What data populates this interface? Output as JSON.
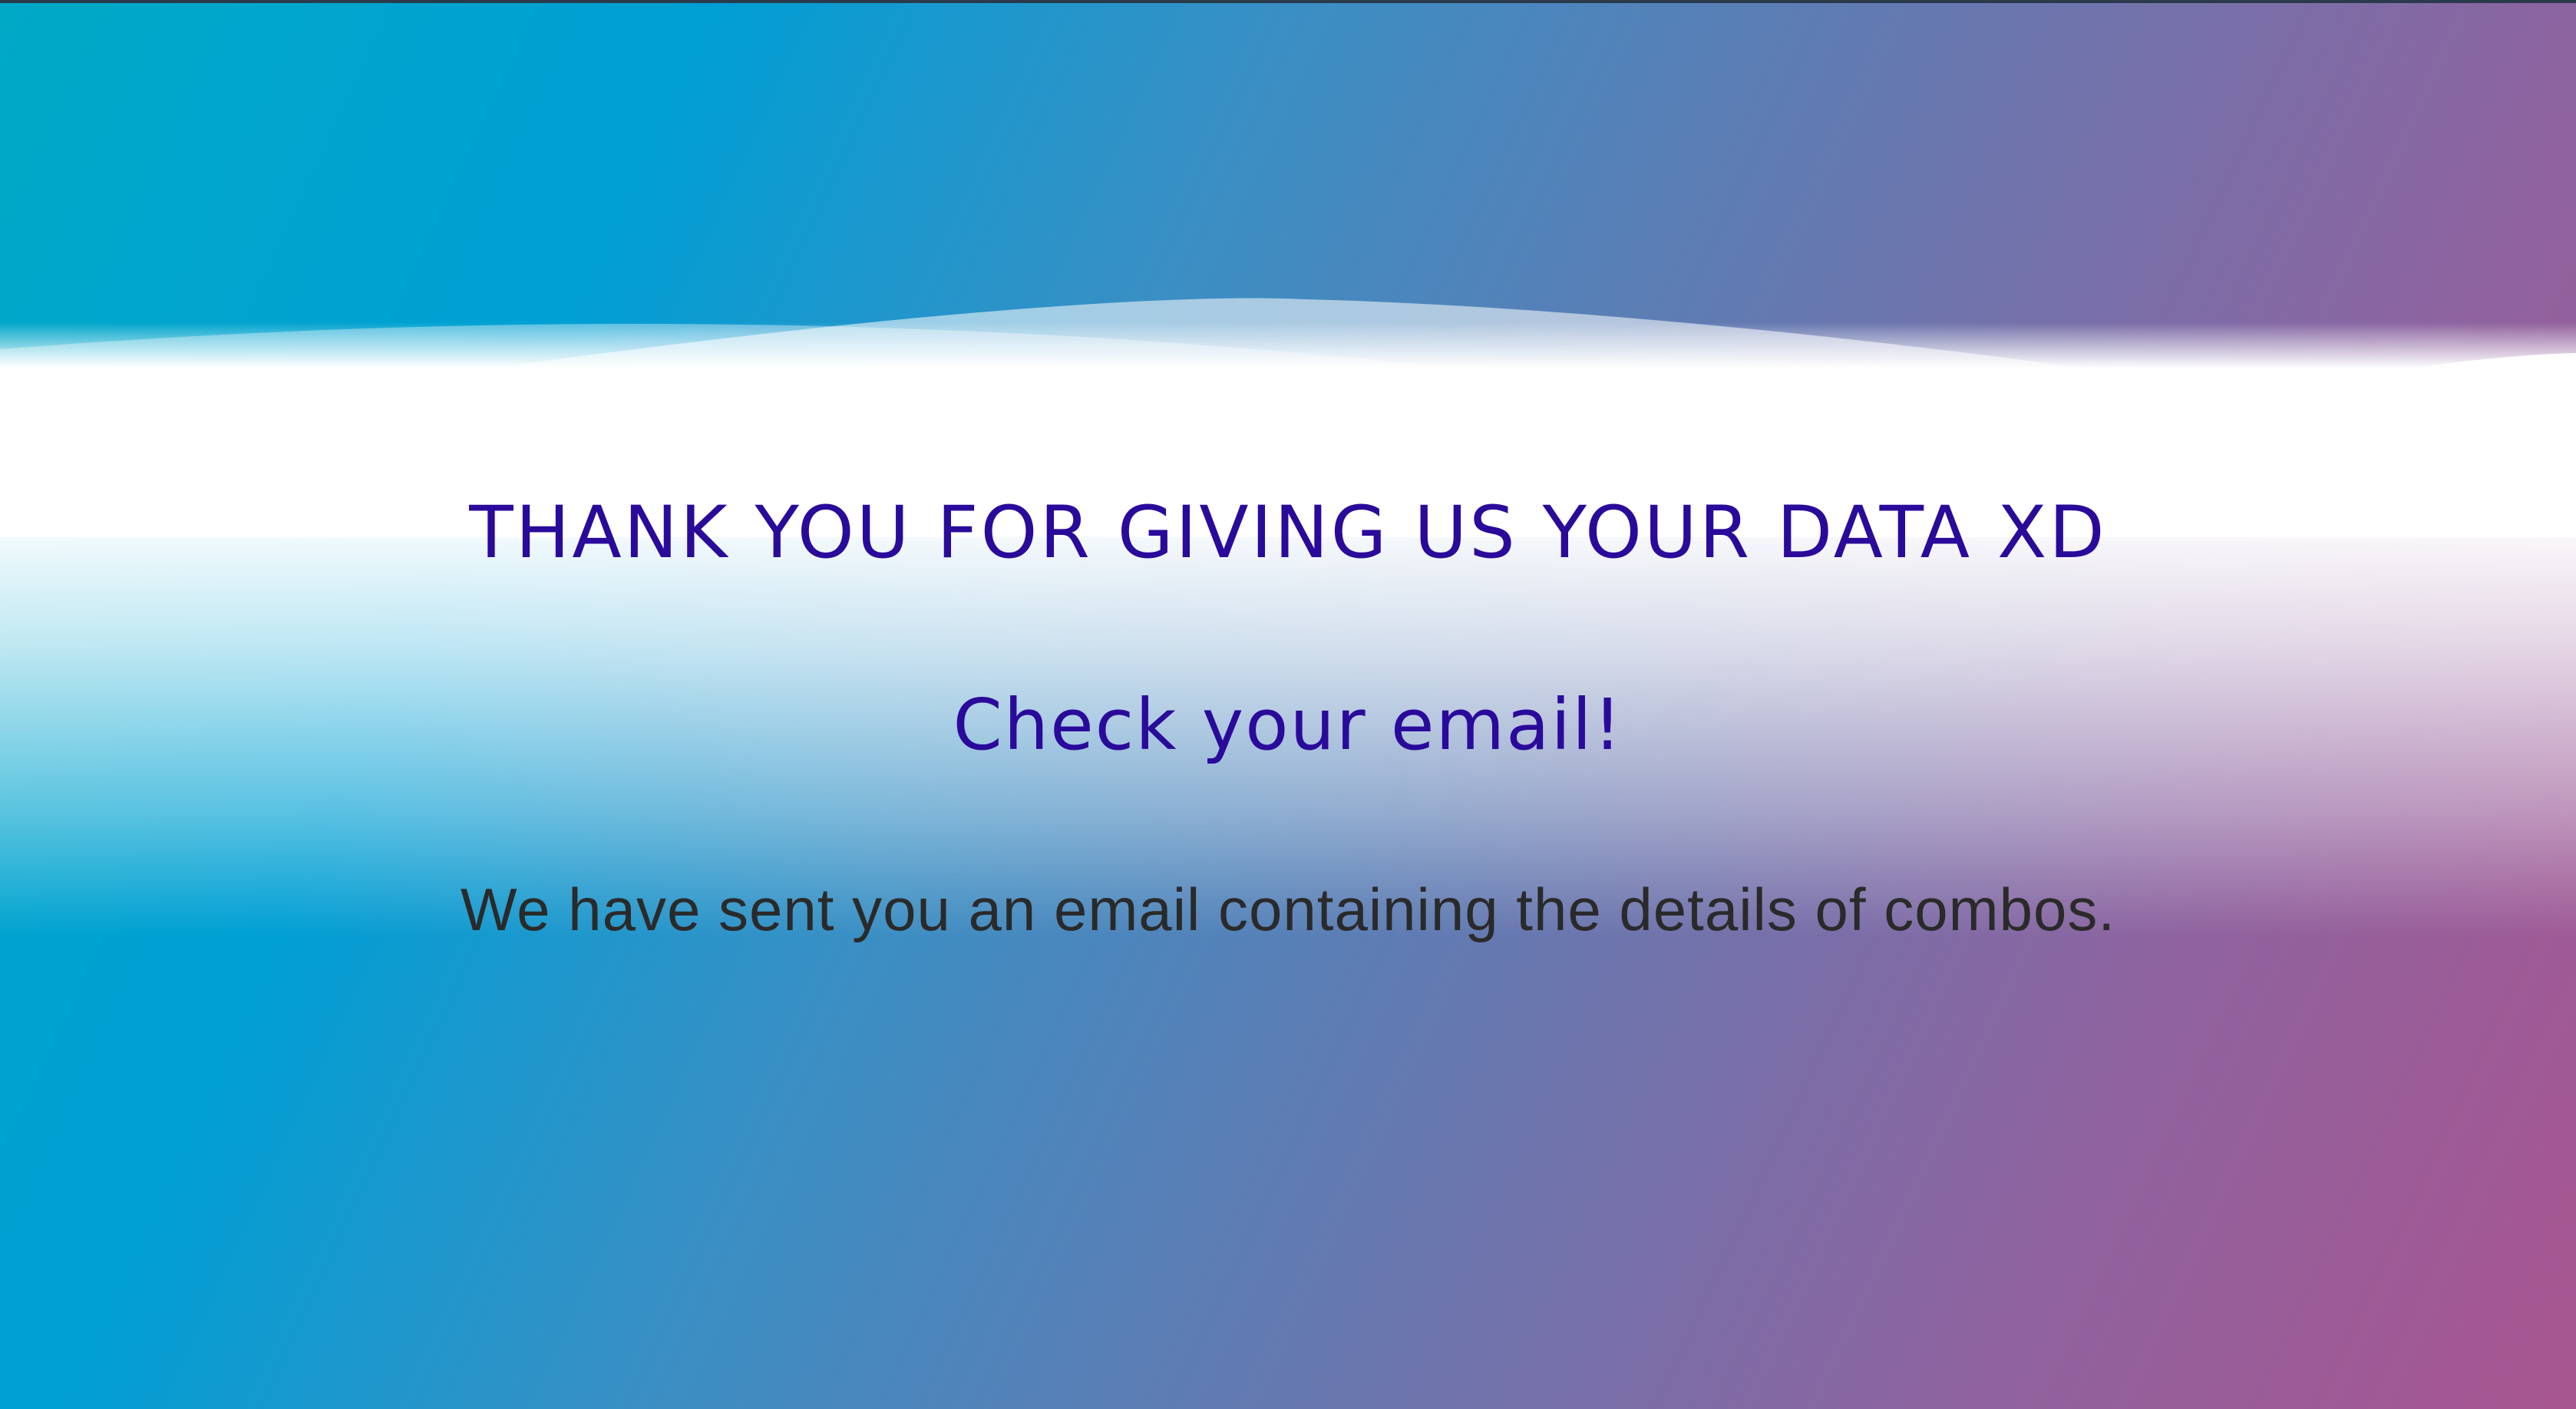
{
  "page": {
    "headline": "THANK YOU FOR GIVING US YOUR DATA XD",
    "subheadline": "Check your email!",
    "message": "We have sent you an email containing the details of combos."
  },
  "colors": {
    "accent_text": "#2a0a9a",
    "body_text": "#2a2a2a",
    "gradient_start": "#00a9c6",
    "gradient_end": "#a85590"
  }
}
